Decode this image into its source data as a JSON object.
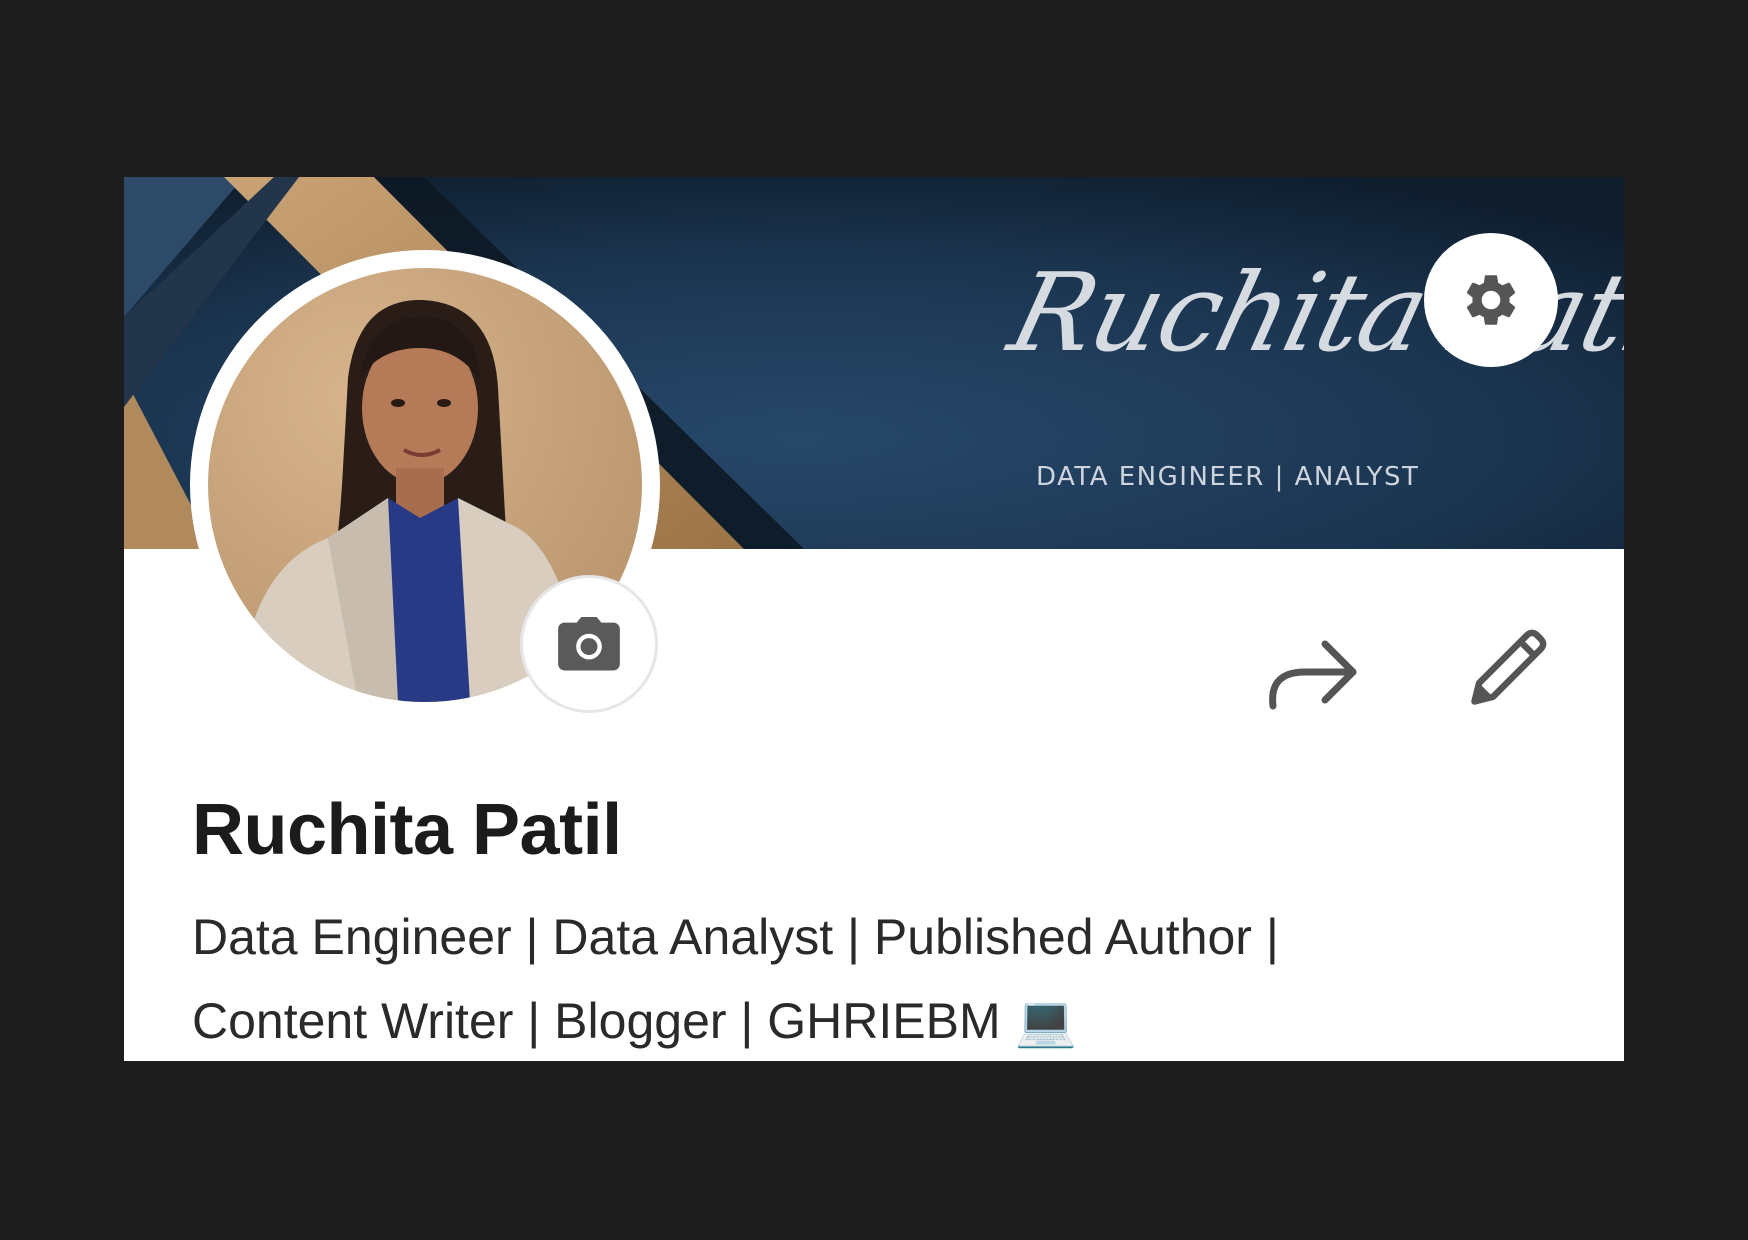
{
  "banner": {
    "signature_text": "Ruchita Patil",
    "subtitle": "DATA ENGINEER | ANALYST",
    "colors": {
      "navy": "#1c3652",
      "navy_dark": "#0f1d2c",
      "gold": "#b58e5f"
    }
  },
  "profile": {
    "name": "Ruchita Patil",
    "headline_line1": "Data Engineer | Data Analyst | Published Author |",
    "headline_line2": "Content Writer | Blogger | GHRIEBM 💻"
  },
  "actions": {
    "settings_icon": "gear-icon",
    "camera_icon": "camera-icon",
    "share_icon": "share-arrow-icon",
    "edit_icon": "pencil-icon"
  }
}
